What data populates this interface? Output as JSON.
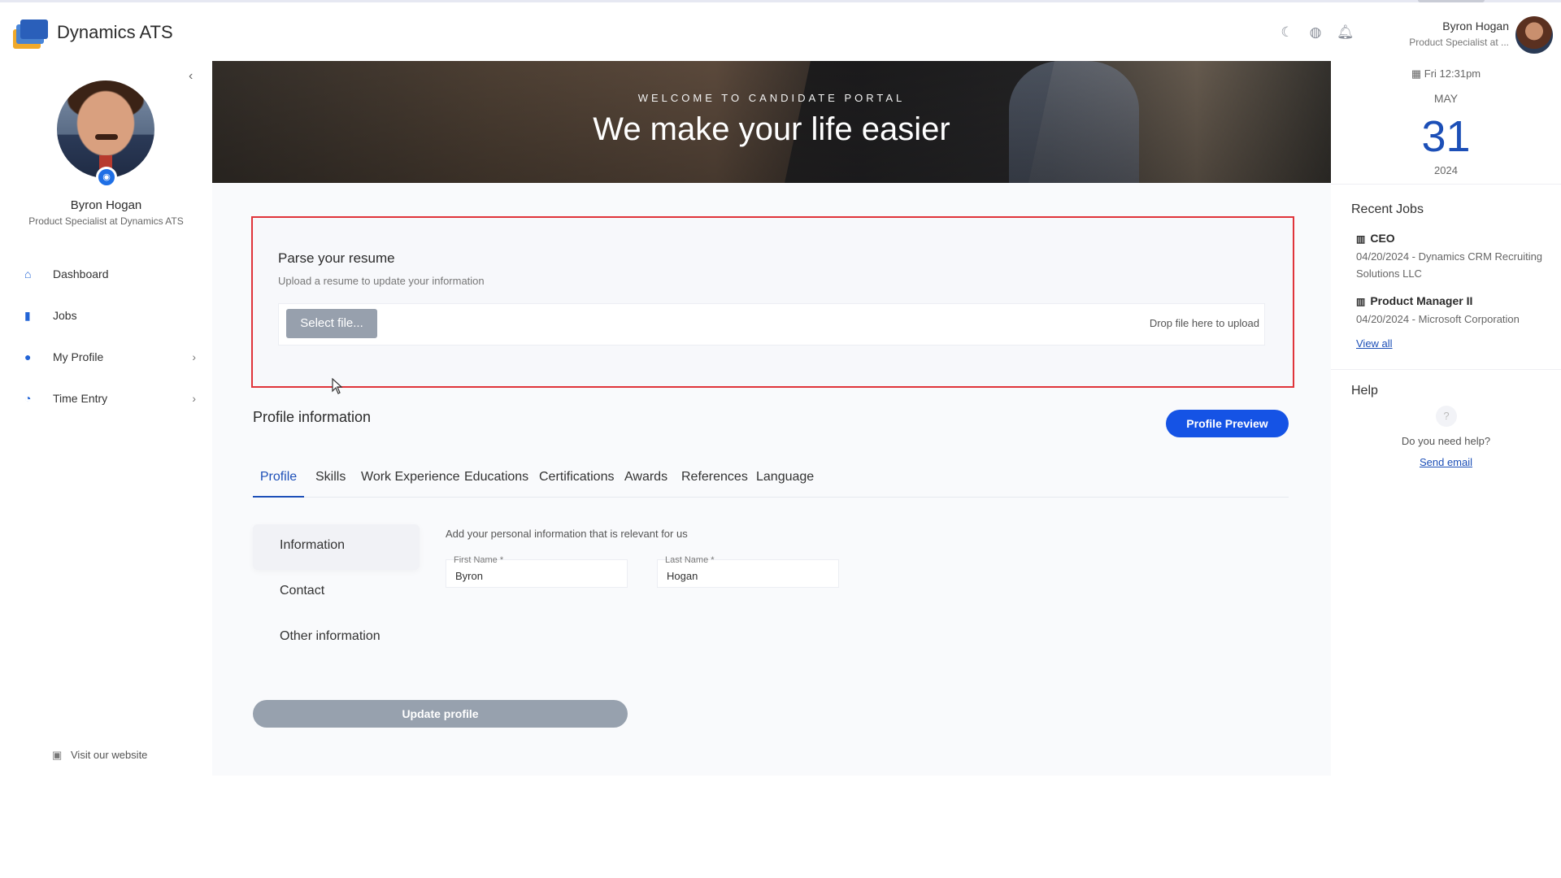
{
  "header": {
    "app_title": "Dynamics ATS",
    "user_name": "Byron Hogan",
    "user_role": "Product Specialist at ...",
    "icons": [
      "moon-icon",
      "globe-icon",
      "bell-icon"
    ]
  },
  "sidebar": {
    "name": "Byron Hogan",
    "role": "Product Specialist at Dynamics ATS",
    "nav": [
      {
        "label": "Dashboard",
        "icon": "home-icon"
      },
      {
        "label": "Jobs",
        "icon": "briefcase-icon"
      },
      {
        "label": "My Profile",
        "icon": "user-icon"
      },
      {
        "label": "Time Entry",
        "icon": "clock-icon"
      }
    ],
    "visit_label": "Visit our website"
  },
  "hero": {
    "kicker": "WELCOME TO CANDIDATE PORTAL",
    "title": "We make your life easier"
  },
  "parse": {
    "title": "Parse your resume",
    "subtitle": "Upload a resume to update your information",
    "select_label": "Select file...",
    "drop_label": "Drop file here to upload"
  },
  "profile": {
    "title": "Profile information",
    "preview_label": "Profile Preview",
    "tabs": [
      "Profile",
      "Skills",
      "Work Experience",
      "Educations",
      "Certifications",
      "Awards",
      "References",
      "Language"
    ],
    "active_tab": "Profile",
    "subnav": [
      "Information",
      "Contact",
      "Other information"
    ],
    "form_subtitle": "Add your personal information that is relevant for us",
    "first_name_label": "First Name *",
    "first_name_value": "Byron",
    "last_name_label": "Last Name *",
    "last_name_value": "Hogan",
    "update_label": "Update profile"
  },
  "right": {
    "date_line": "Fri 12:31pm",
    "month": "MAY",
    "day": "31",
    "year": "2024",
    "recent_jobs_title": "Recent Jobs",
    "jobs": [
      {
        "title": "CEO",
        "meta": "04/20/2024 - Dynamics CRM Recruiting Solutions LLC"
      },
      {
        "title": "Product Manager II",
        "meta": "04/20/2024 - Microsoft Corporation"
      }
    ],
    "view_all": "View all",
    "help_title": "Help",
    "help_text": "Do you need help?",
    "send_email": "Send email"
  },
  "colors": {
    "accent": "#1553e5",
    "highlight_border": "#e0343a",
    "disabled_button": "#97a0ad"
  }
}
